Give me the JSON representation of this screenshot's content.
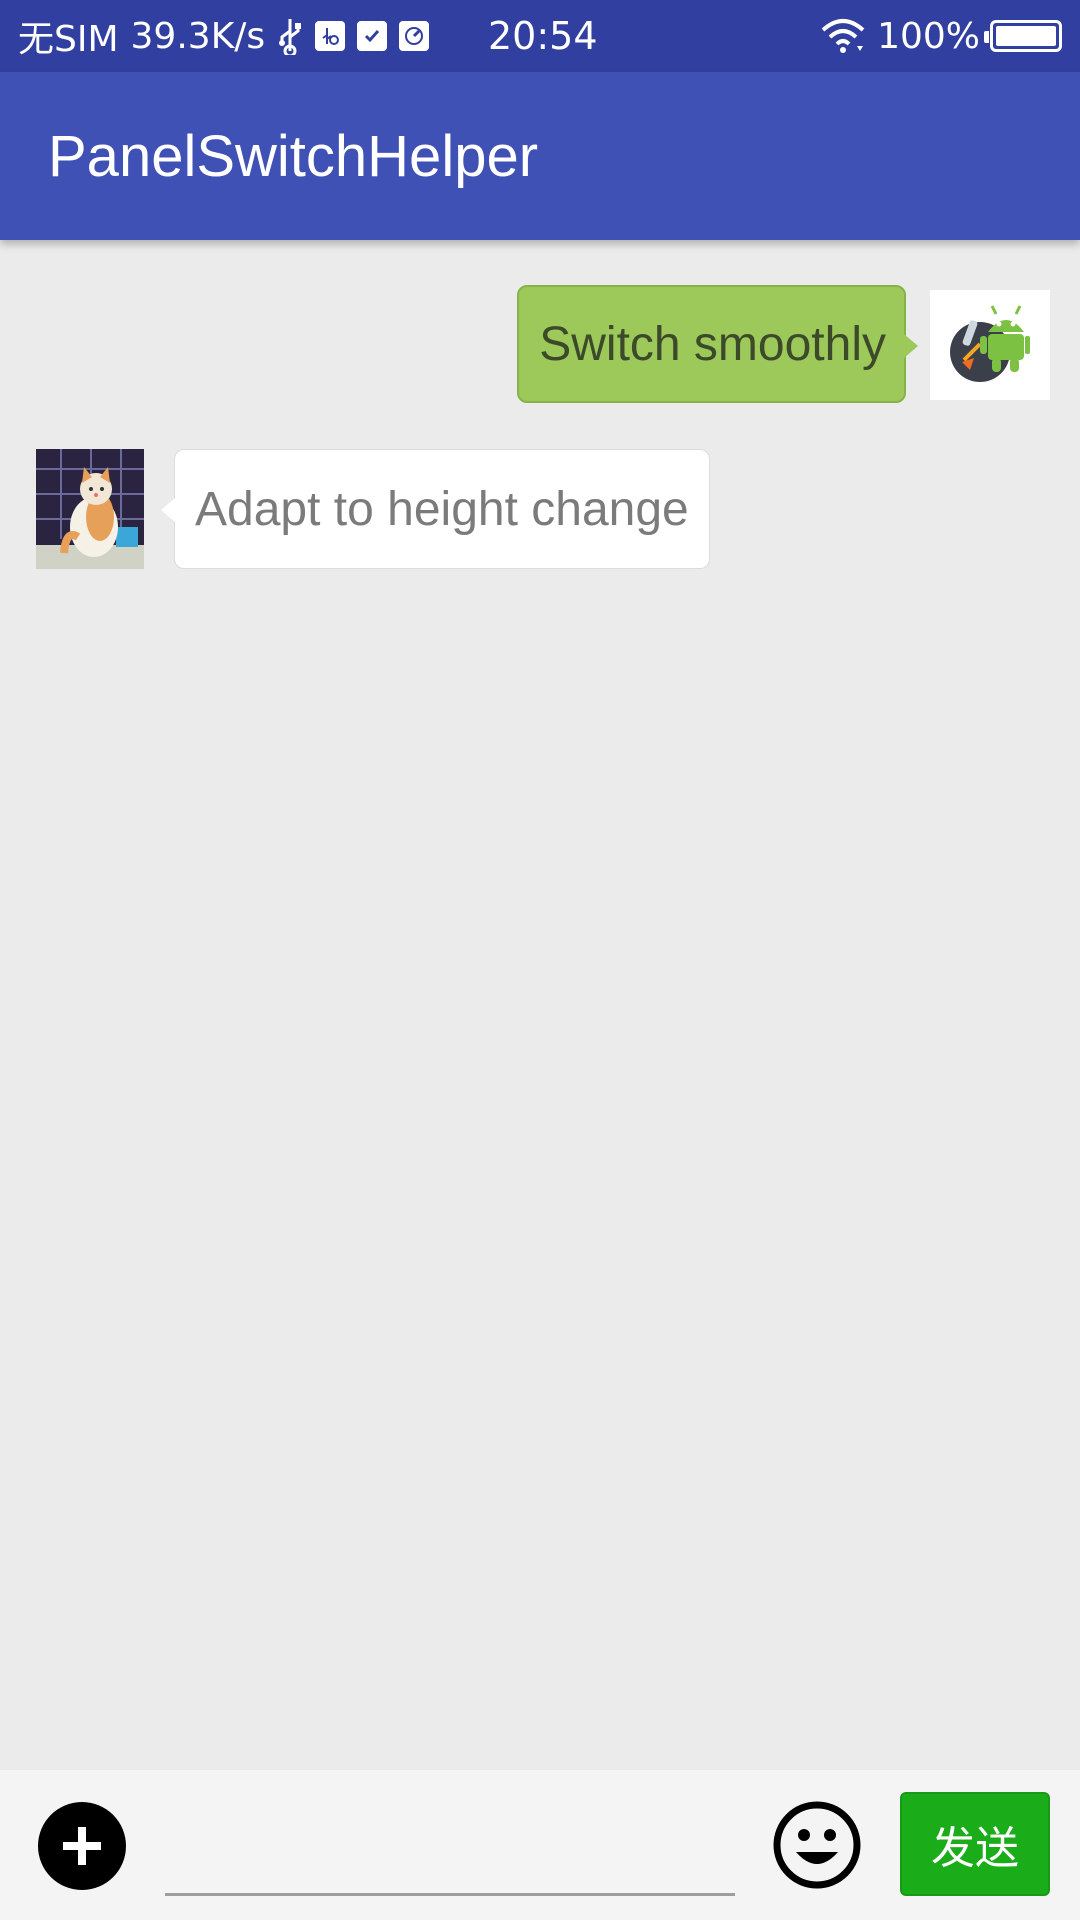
{
  "status_bar": {
    "carrier": "无SIM",
    "net_speed": "39.3K/s",
    "time": "20:54",
    "battery": "100%",
    "icons": [
      "usb-icon",
      "usb-debug-icon",
      "task-check-icon",
      "speedometer-icon",
      "wifi-icon",
      "battery-icon"
    ]
  },
  "app_bar": {
    "title": "PanelSwitchHelper",
    "color": "#3f51b5",
    "status_color": "#3140a0"
  },
  "messages": [
    {
      "direction": "outgoing",
      "text": "Switch smoothly",
      "avatar": "android-rocket-avatar",
      "bubble_color": "#9cc95a"
    },
    {
      "direction": "incoming",
      "text": "Adapt to height change",
      "avatar": "cat-photo-avatar",
      "bubble_color": "#ffffff"
    }
  ],
  "input_bar": {
    "input_value": "",
    "plus_icon": "plus-circle-icon",
    "emoji_icon": "smiley-icon",
    "send_label": "发送",
    "send_color": "#1aad19"
  }
}
